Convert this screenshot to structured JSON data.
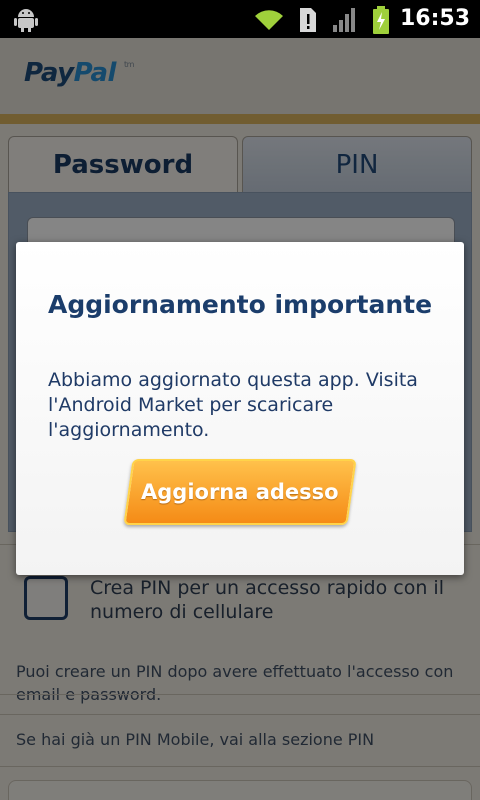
{
  "status_bar": {
    "time": "16:53",
    "icons": [
      "android-debug-icon",
      "wifi-icon",
      "sim-alert-icon",
      "signal-icon",
      "battery-charging-icon"
    ]
  },
  "header": {
    "logo_pay": "Pay",
    "logo_pal": "Pal",
    "logo_tm": "tm"
  },
  "tabs": [
    {
      "label": "Password",
      "active": true
    },
    {
      "label": "PIN",
      "active": false
    }
  ],
  "pin_option": {
    "checkbox_label": "Crea PIN per un accesso rapido con il numero di cellulare",
    "hint": "Puoi creare un PIN dopo avere effettuato l'accesso con email e password."
  },
  "pin_mobile_note": "Se hai già un PIN Mobile, vai alla sezione PIN",
  "dialog": {
    "title": "Aggiornamento importante",
    "message": "Abbiamo aggiornato questa app. Visita l'Android Market per scaricare l'aggiornamento.",
    "button_label": "Aggiorna adesso"
  },
  "colors": {
    "brand_dark_blue": "#1b3d6b",
    "brand_light_blue": "#2a8fd1",
    "accent_gold": "#d9b25e",
    "button_orange": "#f58b16"
  }
}
